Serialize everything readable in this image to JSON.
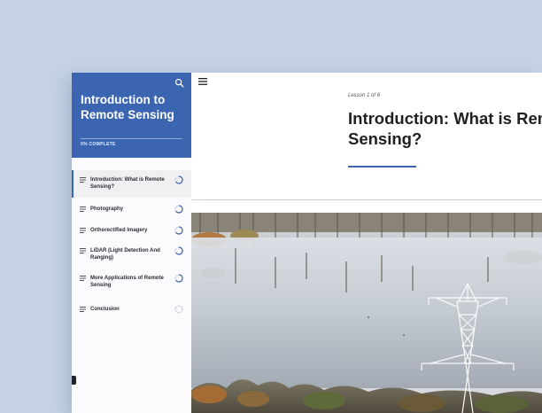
{
  "sidebar": {
    "course_title": "Introduction to Remote Sensing",
    "progress_text": "0% COMPLETE",
    "progress": 0,
    "lessons": [
      {
        "label": "Introduction: What is Remote Sensing?",
        "active": true,
        "status": "in-progress"
      },
      {
        "label": "Photography",
        "active": false,
        "status": "in-progress"
      },
      {
        "label": "Orthorectified Imagery",
        "active": false,
        "status": "in-progress"
      },
      {
        "label": "LiDAR (Light Detection And Ranging)",
        "active": false,
        "status": "in-progress"
      },
      {
        "label": "More Applications of Remote Sensing",
        "active": false,
        "status": "in-progress"
      },
      {
        "label": "Conclusion",
        "active": false,
        "status": "not-started"
      }
    ]
  },
  "main": {
    "lesson_counter": "Lesson 1 of 6",
    "lesson_title_line1": "Introduction: What is Remote",
    "lesson_title_line2": "Sensing?"
  },
  "icons": {
    "search": "search-icon",
    "menu": "menu-icon",
    "lesson": "lesson-list-icon",
    "status": "progress-circle-icon"
  },
  "colors": {
    "accent": "#3b64b1",
    "page_background": "#c5d2e6"
  }
}
